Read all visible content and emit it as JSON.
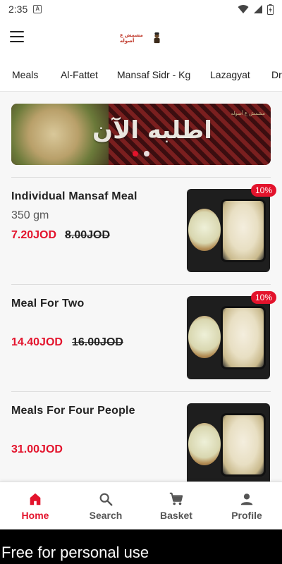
{
  "status": {
    "time": "2:35",
    "app_icon_letter": "A"
  },
  "logo": {
    "text": "مشمش ع أصوله"
  },
  "tabs": [
    {
      "label": "Meals",
      "active": true
    },
    {
      "label": "Al-Fattet"
    },
    {
      "label": "Mansaf Sidr - Kg"
    },
    {
      "label": "Lazagyat"
    },
    {
      "label": "Dr"
    }
  ],
  "banner": {
    "text": "اطلبه الآن",
    "logo_text": "مشمش ع أصوله"
  },
  "items": [
    {
      "name": "Individual Mansaf Meal",
      "weight": "350 gm",
      "price": "7.20JOD",
      "old_price": "8.00JOD",
      "discount": "10%"
    },
    {
      "name": "Meal For Two",
      "weight": "",
      "price": "14.40JOD",
      "old_price": "16.00JOD",
      "discount": "10%"
    },
    {
      "name": "Meals For Four People",
      "weight": "",
      "price": "31.00JOD",
      "old_price": "",
      "discount": ""
    }
  ],
  "nav": {
    "home": "Home",
    "search": "Search",
    "basket": "Basket",
    "profile": "Profile"
  },
  "footer": {
    "text": "Free for personal use"
  },
  "colors": {
    "accent": "#e3132c",
    "text": "#222222",
    "background": "#f7f7f7"
  }
}
